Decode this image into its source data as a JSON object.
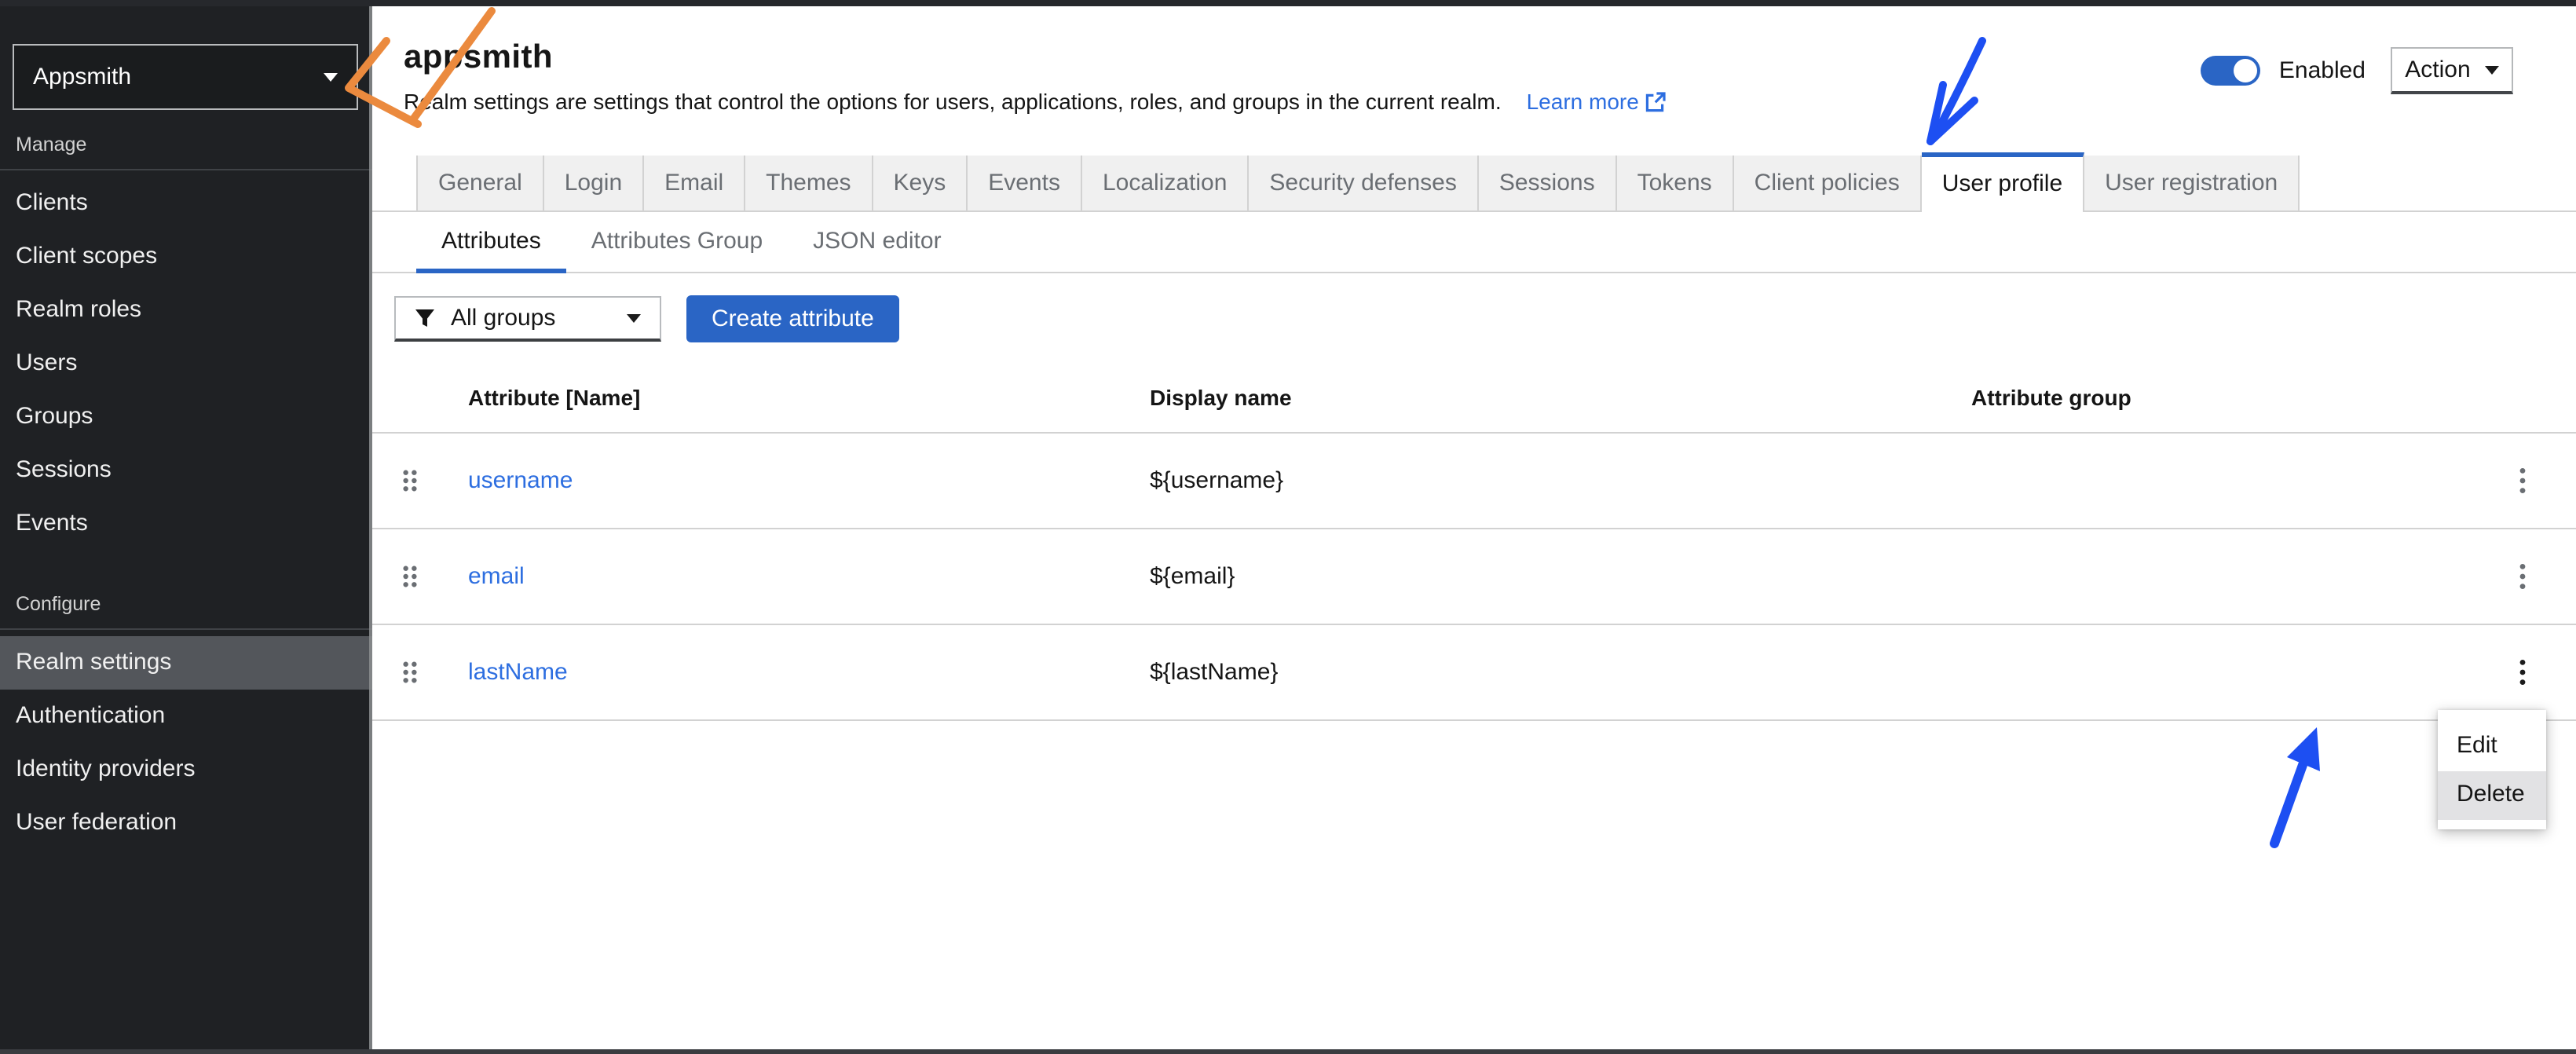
{
  "colors": {
    "accent": "#2a65c5",
    "link": "#2d6ee0",
    "arrow_orange": "#eb8a3e",
    "arrow_blue": "#1d4ff2",
    "sidebar_bg": "#1f2124",
    "sidebar_active_bg": "#53565b",
    "tab_inactive_bg": "#f0f0f0",
    "tab_inactive_text": "#6a6e73"
  },
  "masthead": {
    "realm_selector": "Appsmith"
  },
  "sidebar": {
    "sections": [
      {
        "label": "Manage",
        "items": [
          "Clients",
          "Client scopes",
          "Realm roles",
          "Users",
          "Groups",
          "Sessions",
          "Events"
        ]
      },
      {
        "label": "Configure",
        "items": [
          "Realm settings",
          "Authentication",
          "Identity providers",
          "User federation"
        ],
        "active_item": "Realm settings"
      }
    ]
  },
  "header": {
    "title": "appsmith",
    "description": "Realm settings are settings that control the options for users, applications, roles, and groups in the current realm.",
    "learn_more_label": "Learn more",
    "enabled_label": "Enabled",
    "action_label": "Action"
  },
  "tabs": {
    "active": "User profile",
    "items": [
      "General",
      "Login",
      "Email",
      "Themes",
      "Keys",
      "Events",
      "Localization",
      "Security defenses",
      "Sessions",
      "Tokens",
      "Client policies",
      "User profile",
      "User registration"
    ]
  },
  "subtabs": {
    "active": "Attributes",
    "items": [
      "Attributes",
      "Attributes Group",
      "JSON editor"
    ]
  },
  "toolbar": {
    "filter_value": "All groups",
    "create_button": "Create attribute"
  },
  "table": {
    "columns": [
      "Attribute [Name]",
      "Display name",
      "Attribute group"
    ],
    "rows": [
      {
        "name": "username",
        "display_name": "${username}",
        "group": ""
      },
      {
        "name": "email",
        "display_name": "${email}",
        "group": ""
      },
      {
        "name": "lastName",
        "display_name": "${lastName}",
        "group": ""
      }
    ]
  },
  "context_menu": {
    "items": [
      "Edit",
      "Delete"
    ],
    "highlighted": "Delete"
  }
}
